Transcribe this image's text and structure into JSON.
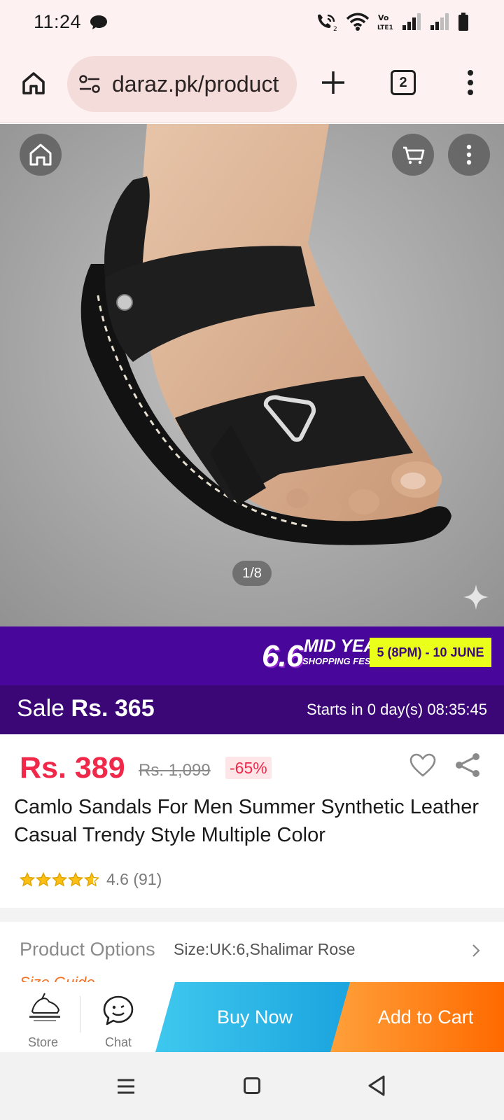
{
  "status_bar": {
    "time": "11:24"
  },
  "browser": {
    "url": "daraz.pk/product",
    "tab_count": "2"
  },
  "gallery": {
    "counter": "1/8"
  },
  "promo": {
    "big": "6.6",
    "mid": "MID YEAR",
    "sub": "SHOPPING FEST!",
    "date": "5 (8PM) - 10 JUNE"
  },
  "sale": {
    "label": "Sale",
    "price": "Rs. 365",
    "timer": "Starts in 0 day(s) 08:35:45"
  },
  "product": {
    "price": "Rs. 389",
    "original_price": "Rs. 1,099",
    "discount": "-65%",
    "title": "Camlo Sandals For Men Summer Synthetic Leather Casual Trendy Style Multiple Color",
    "rating": "4.6",
    "reviews": "(91)",
    "stars": 4.6
  },
  "options": {
    "label": "Product Options",
    "value": "Size:UK:6,Shalimar Rose",
    "size_guide": "Size Guide"
  },
  "action_bar": {
    "store": "Store",
    "chat": "Chat",
    "buy_now": "Buy Now",
    "add_to_cart": "Add to Cart"
  },
  "colors": {
    "price_red": "#f0294a",
    "daraz_orange": "#f57224",
    "promo_purple": "#48079a",
    "buy_blue": "#1aa3de"
  },
  "icons": [
    "home-icon",
    "tune-icon",
    "plus-icon",
    "tabs-icon",
    "more-vert-icon",
    "cart-icon",
    "sparkle-icon",
    "heart-icon",
    "share-icon",
    "star-icon",
    "chevron-right-icon",
    "chat-icon",
    "menu-icon",
    "square-icon",
    "back-icon"
  ]
}
